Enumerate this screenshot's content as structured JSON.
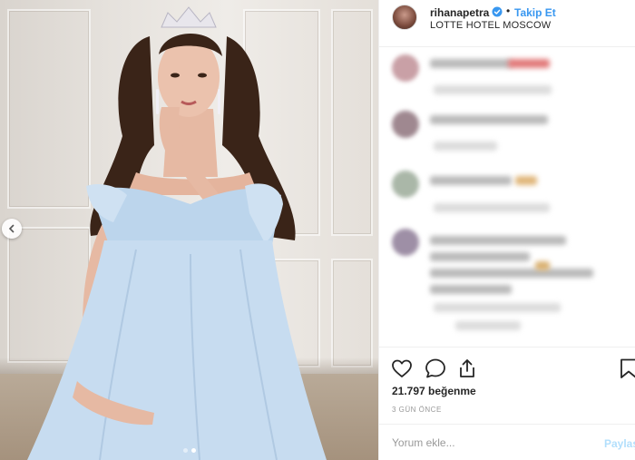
{
  "post": {
    "username": "rihanapetra",
    "follow_label": "Takip Et",
    "separator": "•",
    "location": "LOTTE HOTEL MOSCOW",
    "likes": "21.797 beğenme",
    "time_ago": "3 GÜN ÖNCE",
    "verified": true
  },
  "comment_box": {
    "placeholder": "Yorum ekle...",
    "submit_label": "Paylaş"
  },
  "carousel": {
    "slide_count": 2,
    "active_index": 0
  },
  "icons": {
    "prev": "chevron-left-icon",
    "like": "heart-icon",
    "comment": "comment-bubble-icon",
    "share": "share-upload-icon",
    "save": "bookmark-icon",
    "verified": "verified-badge-icon"
  },
  "colors": {
    "link_blue": "#3897f0",
    "disabled_blue": "#b2dffc",
    "text": "#262626",
    "muted": "#999999",
    "border": "#efefef"
  }
}
